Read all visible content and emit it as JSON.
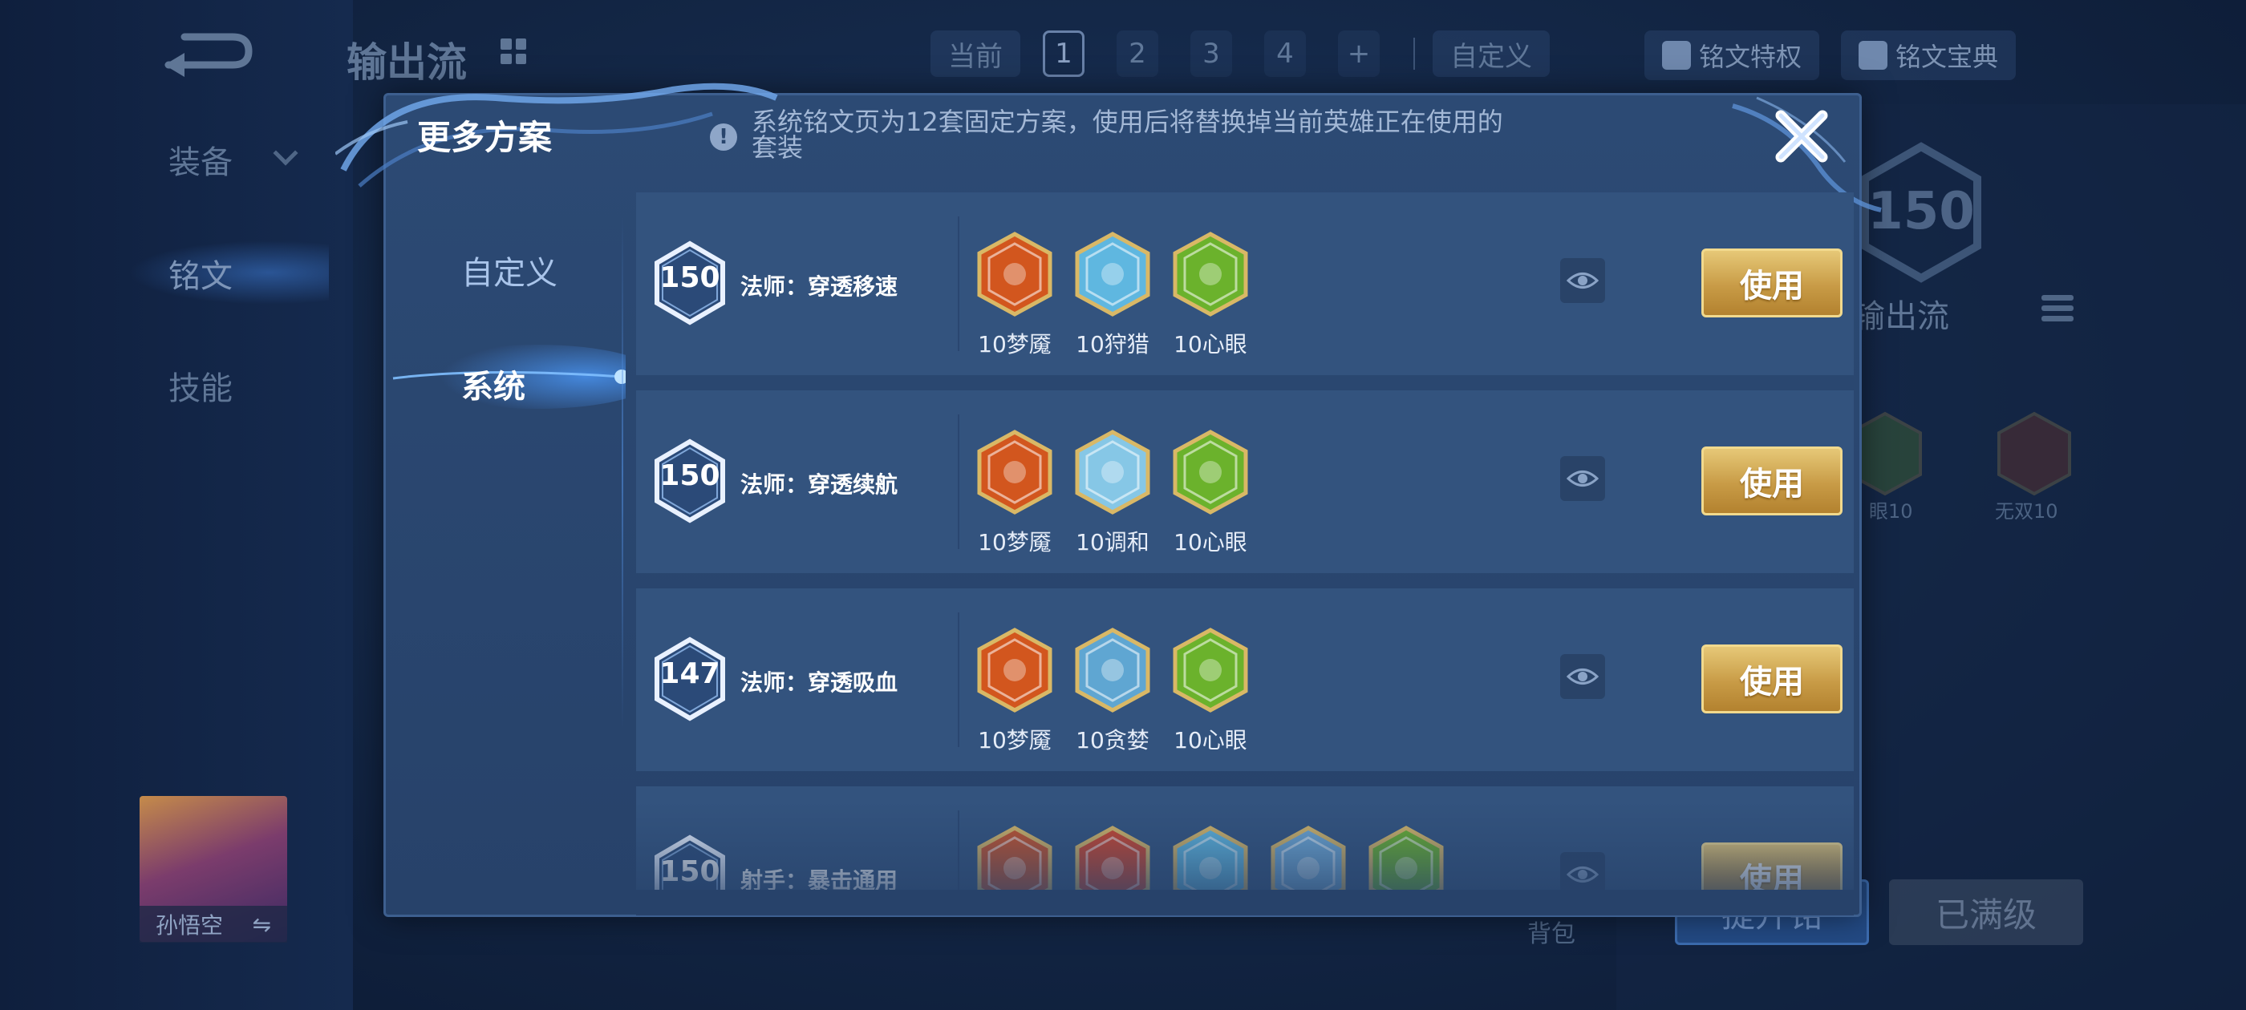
{
  "background": {
    "page_title": "输出流",
    "nav": [
      "装备",
      "铭文",
      "技能"
    ],
    "top_tabs": {
      "current_label": "当前",
      "numbers": [
        "1",
        "2",
        "3",
        "4"
      ],
      "active": "1",
      "add": "+",
      "custom": "自定义"
    },
    "buttons": [
      "铭文特权",
      "铭文宝典"
    ],
    "right_level": "150",
    "right_title": "输出流",
    "faded_gems": [
      "眼10",
      "无双10"
    ],
    "hero_name": "孙悟空",
    "hero_swap_icon": "⇋",
    "bag": "背包",
    "upgrade_button": "提升铭",
    "maxed_button": "已满级"
  },
  "modal": {
    "title": "更多方案",
    "notice": "系统铭文页为12套固定方案，使用后将替换掉当前英雄正在使用的套装",
    "notice_line1": "系统铭文页为12套固定方案，使用后将替换掉当前英雄正在使用的",
    "notice_line2": "套装",
    "info_icon": "!",
    "nav": [
      "自定义",
      "系统"
    ],
    "selected_nav": "系统",
    "use_label": "使用",
    "rows": [
      {
        "level": "150",
        "name": "法师：穿透移速",
        "gems": [
          {
            "label": "10梦魇",
            "icon": "red-flame-gem-icon",
            "color": "#d2561e"
          },
          {
            "label": "10狩猎",
            "icon": "blue-lightning-gem-icon",
            "color": "#5fb7e0"
          },
          {
            "label": "10心眼",
            "icon": "green-gem-icon",
            "color": "#6bb22c"
          }
        ]
      },
      {
        "level": "150",
        "name": "法师：穿透续航",
        "gems": [
          {
            "label": "10梦魇",
            "icon": "red-flame-gem-icon",
            "color": "#d2561e"
          },
          {
            "label": "10调和",
            "icon": "blue-drop-gem-icon",
            "color": "#86c7e6"
          },
          {
            "label": "10心眼",
            "icon": "green-gem-icon",
            "color": "#6bb22c"
          }
        ]
      },
      {
        "level": "147",
        "name": "法师：穿透吸血",
        "gems": [
          {
            "label": "10梦魇",
            "icon": "red-flame-gem-icon",
            "color": "#d2561e"
          },
          {
            "label": "10贪婪",
            "icon": "blue-star-gem-icon",
            "color": "#5fa6d2"
          },
          {
            "label": "10心眼",
            "icon": "green-gem-icon",
            "color": "#6bb22c"
          }
        ]
      },
      {
        "level": "150",
        "name": "射手：暴击通用",
        "gems": [
          {
            "label": "",
            "icon": "red-gem-icon",
            "color": "#c9532a"
          },
          {
            "label": "",
            "icon": "red-gem-icon",
            "color": "#d0452c"
          },
          {
            "label": "",
            "icon": "blue-lightning-gem-icon",
            "color": "#5fb7e0"
          },
          {
            "label": "",
            "icon": "blue-gem-icon",
            "color": "#6fa9d6"
          },
          {
            "label": "",
            "icon": "green-gem-icon",
            "color": "#6bb22c"
          }
        ]
      }
    ]
  }
}
